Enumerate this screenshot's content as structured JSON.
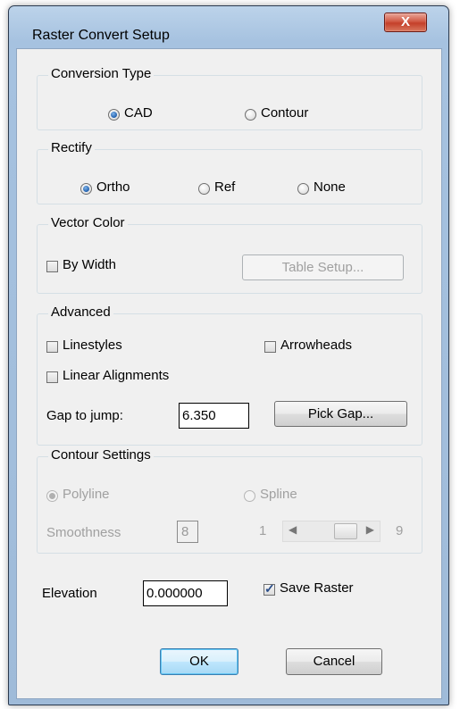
{
  "window": {
    "title": "Raster Convert Setup",
    "close_label": "X"
  },
  "conversion_type": {
    "legend": "Conversion Type",
    "options": [
      {
        "label": "CAD",
        "checked": true
      },
      {
        "label": "Contour",
        "checked": false
      }
    ]
  },
  "rectify": {
    "legend": "Rectify",
    "options": [
      {
        "label": "Ortho",
        "checked": true
      },
      {
        "label": "Ref",
        "checked": false
      },
      {
        "label": "None",
        "checked": false
      }
    ]
  },
  "vector_color": {
    "legend": "Vector Color",
    "by_width_label": "By Width",
    "by_width_checked": false,
    "table_setup_label": "Table Setup..."
  },
  "advanced": {
    "legend": "Advanced",
    "linestyles_label": "Linestyles",
    "arrowheads_label": "Arrowheads",
    "linear_alignments_label": "Linear Alignments",
    "gap_label": "Gap to jump:",
    "gap_value": "6.350",
    "pick_gap_label": "Pick Gap..."
  },
  "contour_settings": {
    "legend": "Contour Settings",
    "polyline_label": "Polyline",
    "spline_label": "Spline",
    "smoothness_label": "Smoothness",
    "smoothness_value": "8",
    "slider_min": "1",
    "slider_max": "9",
    "slider_value": 8
  },
  "elevation": {
    "label": "Elevation",
    "value": "0.000000"
  },
  "save_raster": {
    "label": "Save Raster",
    "checked": true
  },
  "buttons": {
    "ok": "OK",
    "cancel": "Cancel"
  }
}
